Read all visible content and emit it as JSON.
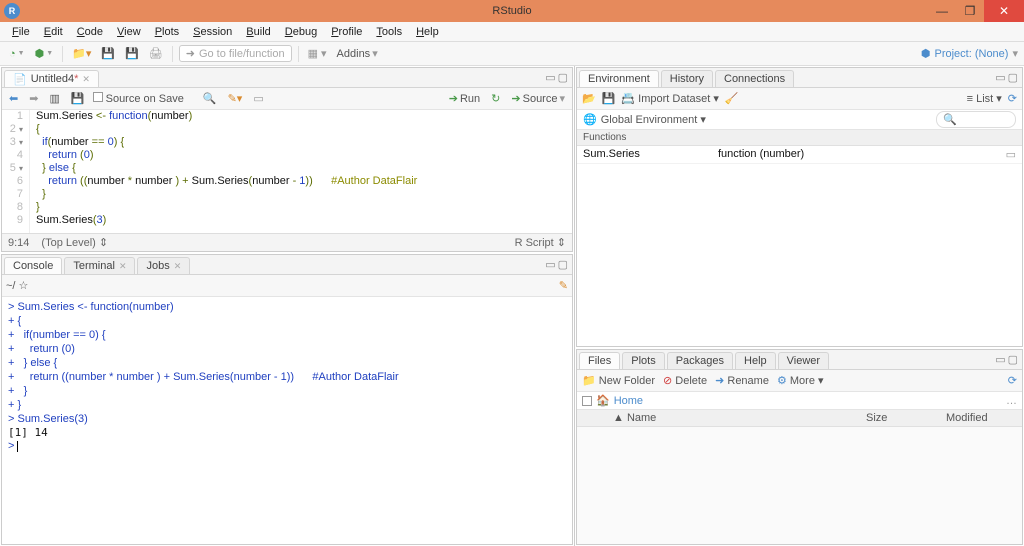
{
  "window": {
    "title": "RStudio"
  },
  "menu": [
    "File",
    "Edit",
    "Code",
    "View",
    "Plots",
    "Session",
    "Build",
    "Debug",
    "Profile",
    "Tools",
    "Help"
  ],
  "toolbar": {
    "goto_placeholder": "Go to file/function",
    "addins": "Addins",
    "project": "Project: (None)"
  },
  "editor": {
    "tab_label": "Untitled4",
    "tab_dirty": "*",
    "source_on_save": "Source on Save",
    "run": "Run",
    "source": "Source",
    "status_pos": "9:14",
    "status_scope": "(Top Level)",
    "status_lang": "R Script",
    "lines": [
      {
        "n": "1",
        "fold": "",
        "html": "Sum.Series <span class='op'>&lt;-</span> <span class='kw'>function</span><span class='paren'>(</span>number<span class='paren'>)</span>"
      },
      {
        "n": "2",
        "fold": "▾",
        "html": "<span class='brace'>{</span>"
      },
      {
        "n": "3",
        "fold": "▾",
        "html": "  <span class='kw'>if</span><span class='paren'>(</span>number <span class='op'>==</span> <span class='num'>0</span><span class='paren'>)</span> <span class='brace'>{</span>"
      },
      {
        "n": "4",
        "fold": "",
        "html": "    <span class='kw'>return</span> <span class='paren'>(</span><span class='num'>0</span><span class='paren'>)</span>"
      },
      {
        "n": "5",
        "fold": "▾",
        "html": "  <span class='brace'>}</span> <span class='kw'>else</span> <span class='brace'>{</span>"
      },
      {
        "n": "6",
        "fold": "",
        "html": "    <span class='kw'>return</span> <span class='paren'>((</span>number <span class='op'>*</span> number <span class='paren'>)</span> <span class='op'>+</span> Sum.Series<span class='paren'>(</span>number <span class='op'>-</span> <span class='num'>1</span><span class='paren'>))</span>      <span class='cmt'>#Author DataFlair</span>"
      },
      {
        "n": "7",
        "fold": "",
        "html": "  <span class='brace'>}</span>"
      },
      {
        "n": "8",
        "fold": "",
        "html": "<span class='brace'>}</span>"
      },
      {
        "n": "9",
        "fold": "",
        "html": "Sum.Series<span class='paren'>(</span><span class='num'>3</span><span class='paren'>)</span>"
      }
    ]
  },
  "console": {
    "tabs": [
      "Console",
      "Terminal",
      "Jobs"
    ],
    "path": "~/",
    "lines": [
      "<span class='blue'>&gt; Sum.Series &lt;- function(number)</span>",
      "<span class='blue'>+ {</span>",
      "<span class='blue'>+   if(number == 0) {</span>",
      "<span class='blue'>+     return (0)</span>",
      "<span class='blue'>+   } else {</span>",
      "<span class='blue'>+     return ((number * number ) + Sum.Series(number - 1))      #Author DataFlair</span>",
      "<span class='blue'>+   }</span>",
      "<span class='blue'>+ }</span>",
      "<span class='blue'>&gt; Sum.Series(3)</span>",
      "[1] 14",
      "<span class='blue'>&gt; </span><span class='cursor'></span>"
    ]
  },
  "env": {
    "tabs": [
      "Environment",
      "History",
      "Connections"
    ],
    "import": "Import Dataset",
    "list": "List",
    "scope": "Global Environment",
    "section": "Functions",
    "row_name": "Sum.Series",
    "row_val": "function (number)"
  },
  "files": {
    "tabs": [
      "Files",
      "Plots",
      "Packages",
      "Help",
      "Viewer"
    ],
    "new_folder": "New Folder",
    "delete": "Delete",
    "rename": "Rename",
    "more": "More",
    "home": "Home",
    "cols": {
      "name": "Name",
      "size": "Size",
      "modified": "Modified"
    }
  }
}
